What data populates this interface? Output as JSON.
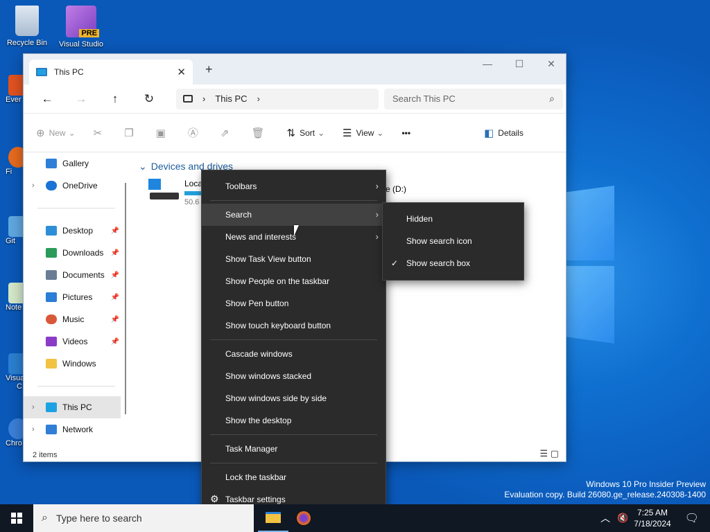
{
  "desktop": {
    "icons": [
      {
        "label": "Recycle Bin"
      },
      {
        "label": "Visual Studio",
        "badge": "PRE"
      }
    ],
    "edge_icons": [
      {
        "label": "Ever"
      },
      {
        "label": "Fi"
      },
      {
        "label": "Git"
      },
      {
        "label": "Note"
      },
      {
        "label": "Visua"
      },
      {
        "label": "C"
      },
      {
        "label": "Chro"
      }
    ],
    "watermark": {
      "line1": "Windows 10 Pro Insider Preview",
      "line2": "Evaluation copy. Build 26080.ge_release.240308-1400"
    }
  },
  "explorer": {
    "tab_title": "This PC",
    "address": {
      "segment": "This PC"
    },
    "search_placeholder": "Search This PC",
    "commands": {
      "new": "New",
      "sort": "Sort",
      "view": "View",
      "more": "•••",
      "details": "Details"
    },
    "sidebar": [
      {
        "label": "Gallery",
        "color": "#2f7fd6"
      },
      {
        "label": "OneDrive",
        "color": "#1a73d6",
        "expand": true
      },
      {
        "label": "Desktop",
        "color": "#2f8fd6",
        "pinned": true
      },
      {
        "label": "Downloads",
        "color": "#2a9b5a",
        "pinned": true
      },
      {
        "label": "Documents",
        "color": "#6a7d95",
        "pinned": true
      },
      {
        "label": "Pictures",
        "color": "#2b7dd6",
        "pinned": true
      },
      {
        "label": "Music",
        "color": "#d9583a",
        "pinned": true
      },
      {
        "label": "Videos",
        "color": "#8a3cc8",
        "pinned": true
      },
      {
        "label": "Windows",
        "color": "#f2c243"
      },
      {
        "label": "This PC",
        "color": "#1fa2e3",
        "expand": true,
        "selected": true
      },
      {
        "label": "Network",
        "color": "#2f7fd6",
        "expand": true
      }
    ],
    "group_heading": "Devices and drives",
    "drives": [
      {
        "label": "Loca",
        "detail": "50.6"
      },
      {
        "label": "e (D:)"
      }
    ],
    "status": "2 items"
  },
  "context_menu": {
    "items": [
      {
        "label": "Toolbars",
        "submenu": true
      },
      {
        "label": "Search",
        "submenu": true,
        "highlighted": true
      },
      {
        "label": "News and interests",
        "submenu": true
      },
      {
        "label": "Show Task View button"
      },
      {
        "label": "Show People on the taskbar"
      },
      {
        "label": "Show Pen button"
      },
      {
        "label": "Show touch keyboard button"
      },
      {
        "label": "Cascade windows"
      },
      {
        "label": "Show windows stacked"
      },
      {
        "label": "Show windows side by side"
      },
      {
        "label": "Show the desktop"
      },
      {
        "label": "Task Manager"
      },
      {
        "label": "Lock the taskbar"
      },
      {
        "label": "Taskbar settings"
      }
    ]
  },
  "search_submenu": {
    "items": [
      {
        "label": "Hidden",
        "checked": false
      },
      {
        "label": "Show search icon",
        "checked": false
      },
      {
        "label": "Show search box",
        "checked": true
      }
    ]
  },
  "taskbar": {
    "search_placeholder": "Type here to search",
    "time": "7:25 AM",
    "date": "7/18/2024"
  }
}
